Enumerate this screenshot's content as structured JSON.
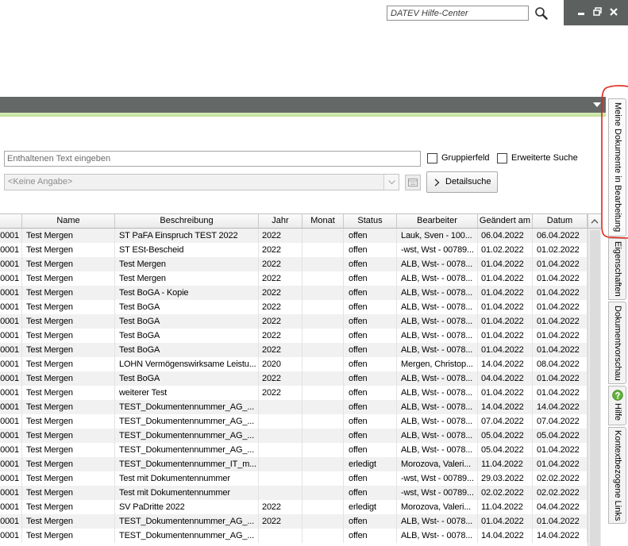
{
  "window": {
    "help_search_placeholder": "DATEV Hilfe-Center",
    "icons": {
      "help_search": "search-icon",
      "minimize": "minimize-icon",
      "restore": "restore-icon",
      "close": "close-icon",
      "band_dropdown": "triangle-down-icon"
    }
  },
  "search": {
    "text_placeholder": "Enthaltenen Text eingeben",
    "group_field": {
      "label": "Gruppierfeld",
      "checked": false
    },
    "extended_search": {
      "label": "Erweiterte Suche",
      "checked": false
    },
    "category_select": {
      "value": "<Keine Angabe>",
      "enabled": false
    },
    "detail_button_label": "Detailsuche",
    "icons": {
      "select_arrow": "chevron-down-icon",
      "list_button": "list-icon",
      "detail_button": "chevron-right-icon"
    }
  },
  "table": {
    "columns": [
      "",
      "Name",
      "Beschreibung",
      "Jahr",
      "Monat",
      "Status",
      "Bearbeiter",
      "Geändert am",
      "Datum"
    ],
    "rows": [
      [
        "0001",
        "Test Mergen",
        "ST PaFA Einspruch TEST 2022",
        "2022",
        "",
        "offen",
        "Lauk, Sven - 100...",
        "06.04.2022",
        "06.04.2022"
      ],
      [
        "0001",
        "Test Mergen",
        "ST ESt-Bescheid",
        "2022",
        "",
        "offen",
        "-wst, Wst - 00789...",
        "01.02.2022",
        "01.02.2022"
      ],
      [
        "0001",
        "Test Mergen",
        "Test Mergen",
        "2022",
        "",
        "offen",
        "ALB, Wst- - 0078...",
        "01.04.2022",
        "01.04.2022"
      ],
      [
        "0001",
        "Test Mergen",
        "Test Mergen",
        "2022",
        "",
        "offen",
        "ALB, Wst- - 0078...",
        "01.04.2022",
        "01.04.2022"
      ],
      [
        "0001",
        "Test Mergen",
        "Test BoGA - Kopie",
        "2022",
        "",
        "offen",
        "ALB, Wst- - 0078...",
        "01.04.2022",
        "01.04.2022"
      ],
      [
        "0001",
        "Test Mergen",
        "Test BoGA",
        "2022",
        "",
        "offen",
        "ALB, Wst- - 0078...",
        "01.04.2022",
        "01.04.2022"
      ],
      [
        "0001",
        "Test Mergen",
        "Test BoGA",
        "2022",
        "",
        "offen",
        "ALB, Wst- - 0078...",
        "01.04.2022",
        "01.04.2022"
      ],
      [
        "0001",
        "Test Mergen",
        "Test BoGA",
        "2022",
        "",
        "offen",
        "ALB, Wst- - 0078...",
        "01.04.2022",
        "01.04.2022"
      ],
      [
        "0001",
        "Test Mergen",
        "Test BoGA",
        "2022",
        "",
        "offen",
        "ALB, Wst- - 0078...",
        "01.04.2022",
        "01.04.2022"
      ],
      [
        "0001",
        "Test Mergen",
        "LOHN Vermögenswirksame Leistu...",
        "2020",
        "",
        "offen",
        "Mergen, Christop...",
        "14.04.2022",
        "08.04.2022"
      ],
      [
        "0001",
        "Test Mergen",
        "Test BoGA",
        "2022",
        "",
        "offen",
        "ALB, Wst- - 0078...",
        "04.04.2022",
        "01.04.2022"
      ],
      [
        "0001",
        "Test Mergen",
        "weiterer Test",
        "2022",
        "",
        "offen",
        "ALB, Wst- - 0078...",
        "01.04.2022",
        "01.04.2022"
      ],
      [
        "0001",
        "Test Mergen",
        "TEST_Dokumentennummer_AG_...",
        "",
        "",
        "offen",
        "ALB, Wst- - 0078...",
        "14.04.2022",
        "14.04.2022"
      ],
      [
        "0001",
        "Test Mergen",
        "TEST_Dokumentennummer_AG_...",
        "",
        "",
        "offen",
        "ALB, Wst- - 0078...",
        "07.04.2022",
        "07.04.2022"
      ],
      [
        "0001",
        "Test Mergen",
        "TEST_Dokumentennummer_AG_...",
        "",
        "",
        "offen",
        "ALB, Wst- - 0078...",
        "05.04.2022",
        "05.04.2022"
      ],
      [
        "0001",
        "Test Mergen",
        "TEST_Dokumentennummer_AG_...",
        "",
        "",
        "offen",
        "ALB, Wst- - 0078...",
        "05.04.2022",
        "01.04.2022"
      ],
      [
        "0001",
        "Test Mergen",
        "TEST_Dokumentennummer_IT_m...",
        "",
        "",
        "erledigt",
        "Morozova, Valeri...",
        "11.04.2022",
        "01.04.2022"
      ],
      [
        "0001",
        "Test Mergen",
        "Test mit Dokumentennummer",
        "",
        "",
        "offen",
        "-wst, Wst - 00789...",
        "29.03.2022",
        "02.02.2022"
      ],
      [
        "0001",
        "Test Mergen",
        "Test mit Dokumentennummer",
        "",
        "",
        "offen",
        "-wst, Wst - 00789...",
        "02.02.2022",
        "02.02.2022"
      ],
      [
        "0001",
        "Test Mergen",
        "SV PaDritte 2022",
        "2022",
        "",
        "erledigt",
        "Morozova, Valeri...",
        "11.04.2022",
        "04.04.2022"
      ],
      [
        "0001",
        "Test Mergen",
        "TEST_Dokumentennummer_AG_...",
        "2022",
        "",
        "offen",
        "ALB, Wst- - 0078...",
        "01.04.2022",
        "01.04.2022"
      ],
      [
        "0001",
        "Test Mergen",
        "TEST_Dokumentennummer_AG_...",
        "",
        "",
        "offen",
        "ALB, Wst- - 0078...",
        "14.04.2022",
        "14.04.2022"
      ]
    ],
    "icons": {
      "scroll_up": "chevron-up-icon"
    }
  },
  "side_tabs": [
    {
      "label": "Meine Dokumente in Bearbeitung"
    },
    {
      "label": "Eigenschaften"
    },
    {
      "label": "Dokumentvorschau"
    },
    {
      "label": "Hilfe",
      "icon": "help-icon"
    },
    {
      "label": "Kontextbezogene Links"
    }
  ],
  "colors": {
    "title_band": "#646867",
    "accent_stripe": "#c6e2a0",
    "window_controls": "#5c605f",
    "alt_row": "#f1f1f1",
    "help_icon": "#62b23a",
    "annotation_red": "#e2231a"
  }
}
